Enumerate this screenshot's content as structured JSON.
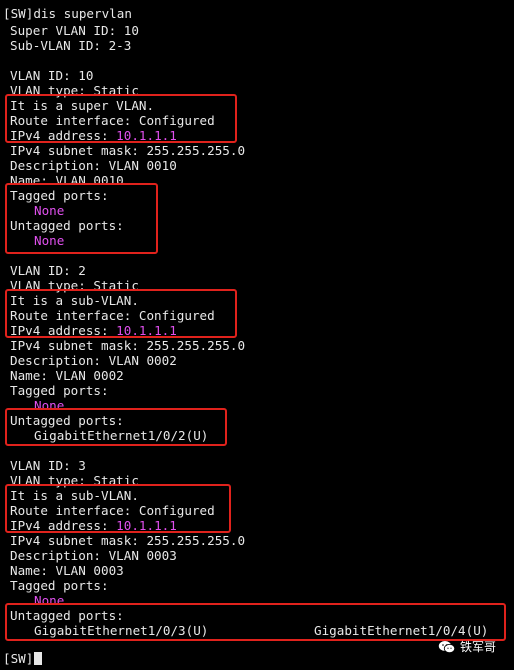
{
  "prompt": "[SW]",
  "command": "dis supervlan",
  "summary": {
    "super_vlan_id": "Super VLAN ID: 10",
    "sub_vlan_id": "Sub-VLAN ID: 2-3"
  },
  "vlans": [
    {
      "id": "VLAN ID: 10",
      "type": "VLAN type: Static",
      "role": "It is a super VLAN.",
      "route": "Route interface: Configured",
      "ipv4_label": "IPv4 address: ",
      "ipv4_value": "10.1.1.1",
      "mask": "IPv4 subnet mask: 255.255.255.0",
      "description": "Description: VLAN 0010",
      "name": "Name: VLAN 0010",
      "tagged_label": "Tagged ports:",
      "tagged_value": "None",
      "untagged_label": "Untagged ports:",
      "untagged_value": "None"
    },
    {
      "id": "VLAN ID: 2",
      "type": "VLAN type: Static",
      "role": "It is a sub-VLAN.",
      "route": "Route interface: Configured",
      "ipv4_label": "IPv4 address: ",
      "ipv4_value": "10.1.1.1",
      "mask": "IPv4 subnet mask: 255.255.255.0",
      "description": "Description: VLAN 0002",
      "name": "Name: VLAN 0002",
      "tagged_label": "Tagged ports:",
      "tagged_value": "None",
      "untagged_label": "Untagged ports:",
      "untagged_value": "GigabitEthernet1/0/2(U)"
    },
    {
      "id": "VLAN ID: 3",
      "type": "VLAN type: Static",
      "role": "It is a sub-VLAN.",
      "route": "Route interface: Configured",
      "ipv4_label": "IPv4 address: ",
      "ipv4_value": "10.1.1.1",
      "mask": "IPv4 subnet mask: 255.255.255.0",
      "description": "Description: VLAN 0003",
      "name": "Name: VLAN 0003",
      "tagged_label": "Tagged ports:",
      "tagged_value": "None",
      "untagged_label": "Untagged ports:",
      "untagged_value": "GigabitEthernet1/0/3(U)",
      "untagged_value_2": "GigabitEthernet1/0/4(U)"
    }
  ],
  "watermark": "铁军哥",
  "colors": {
    "background": "#000000",
    "text": "#e8e8e8",
    "ip_highlight": "#e050ee",
    "annotation_box": "#e0221c"
  }
}
